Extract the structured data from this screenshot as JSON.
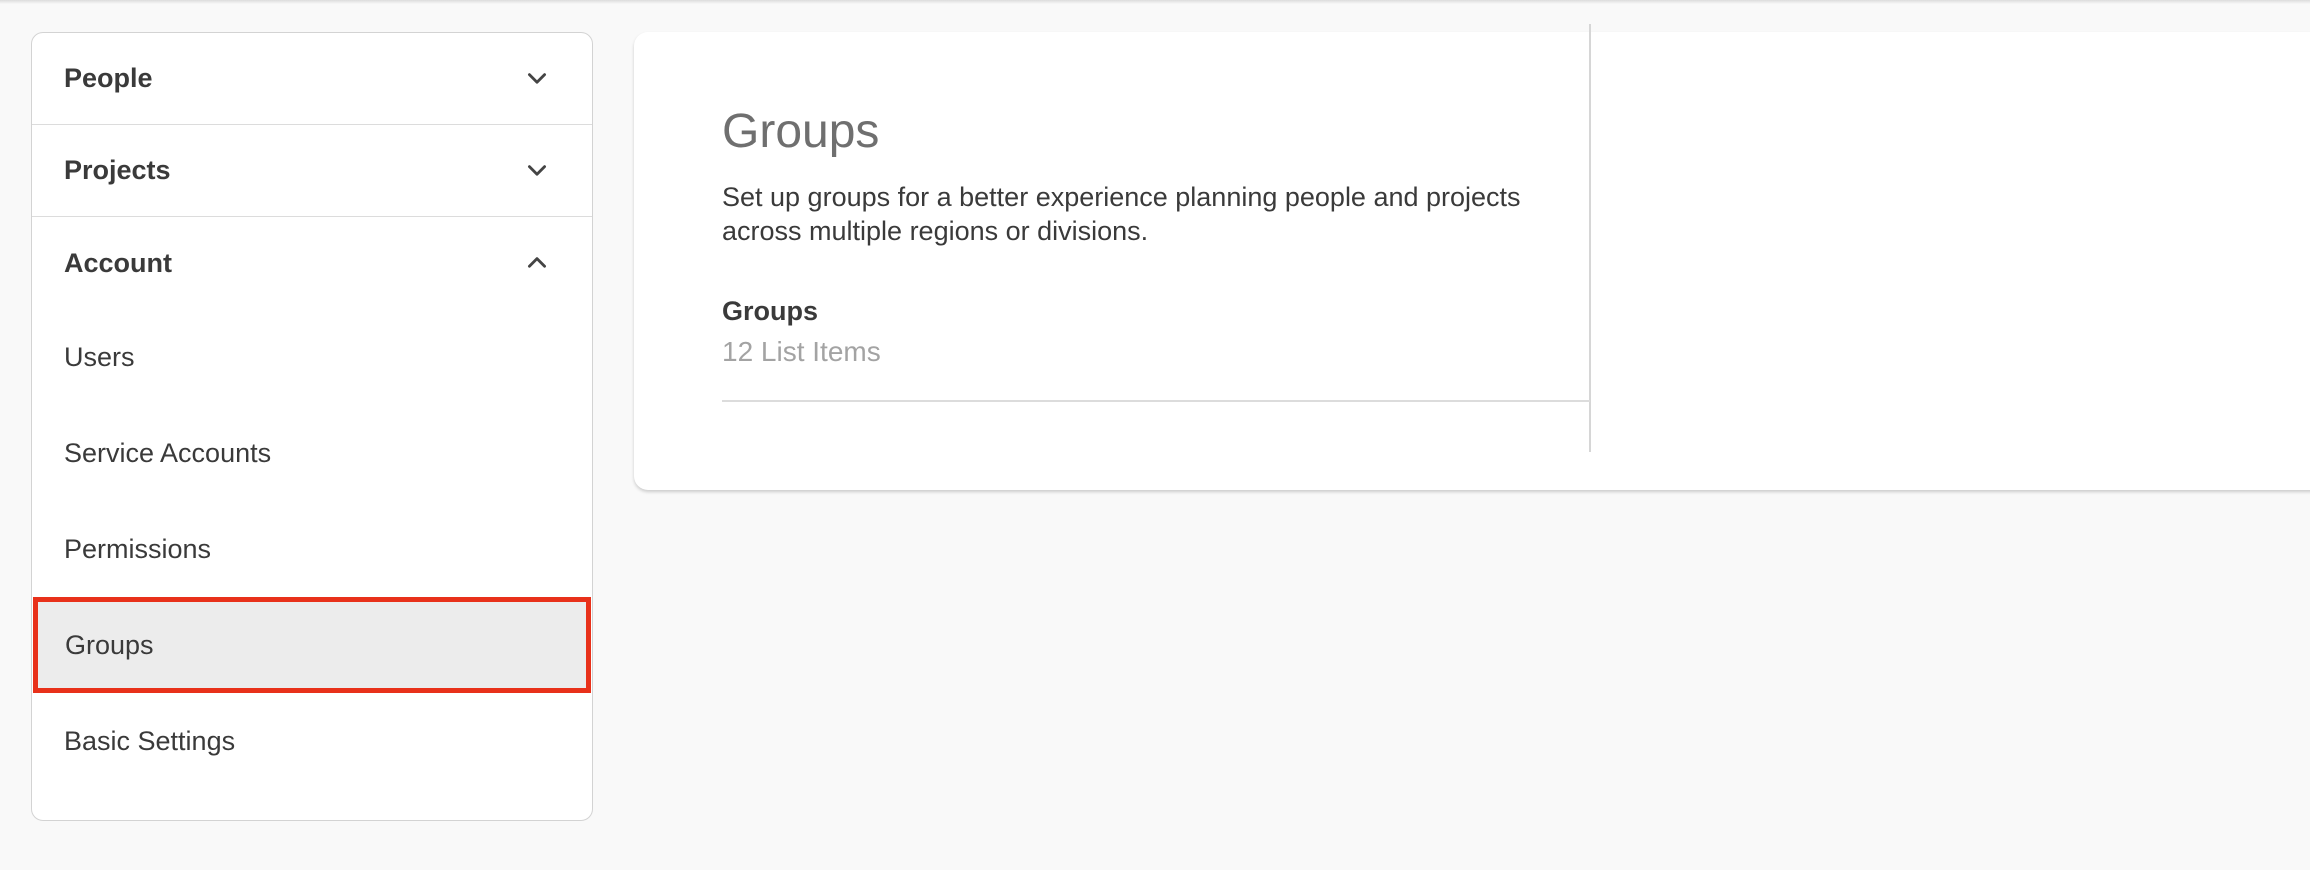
{
  "sidebar": {
    "sections": [
      {
        "label": "People",
        "expanded": false,
        "icon": "chevron-down-icon"
      },
      {
        "label": "Projects",
        "expanded": false,
        "icon": "chevron-down-icon"
      },
      {
        "label": "Account",
        "expanded": true,
        "icon": "chevron-up-icon"
      }
    ],
    "account_items": [
      {
        "label": "Users"
      },
      {
        "label": "Service Accounts"
      },
      {
        "label": "Permissions"
      },
      {
        "label": "Groups",
        "selected": true
      },
      {
        "label": "Basic Settings"
      }
    ]
  },
  "main": {
    "title": "Groups",
    "description": "Set up groups for a better experience planning people and projects across multiple regions or divisions.",
    "list": {
      "label": "Groups",
      "count_text": "12 List Items"
    }
  },
  "colors": {
    "selected_outline": "#e8311a",
    "selected_background": "#ececec",
    "page_background": "#f9f9f9"
  }
}
